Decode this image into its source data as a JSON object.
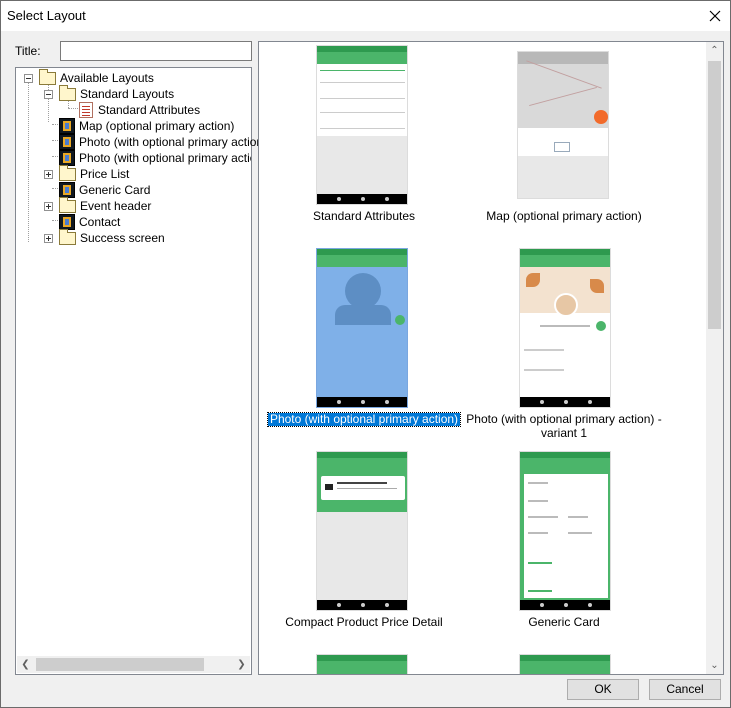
{
  "window": {
    "title": "Select Layout"
  },
  "form": {
    "title_label": "Title:",
    "title_value": ""
  },
  "tree": {
    "root": "Available Layouts",
    "standard_layouts": "Standard Layouts",
    "standard_attributes": "Standard Attributes",
    "map": "Map (optional primary action)",
    "photo": "Photo (with optional primary action)",
    "photo_variant": "Photo (with optional primary action) -",
    "price_list": "Price List",
    "generic_card": "Generic Card",
    "event_header": "Event header",
    "contact": "Contact",
    "success_screen": "Success screen"
  },
  "previews": {
    "standard_attributes": "Standard Attributes",
    "map": "Map (optional primary action)",
    "photo": "Photo (with optional primary action)",
    "photo_variant_line1": "Photo (with optional primary action) -",
    "photo_variant_line2": "variant 1",
    "compact_product": "Compact Product Price Detail",
    "generic_card": "Generic Card"
  },
  "buttons": {
    "ok": "OK",
    "cancel": "Cancel"
  },
  "colors": {
    "selection": "#0078d7",
    "app_green": "#4bb56a",
    "map_pin": "#f26b2b"
  }
}
